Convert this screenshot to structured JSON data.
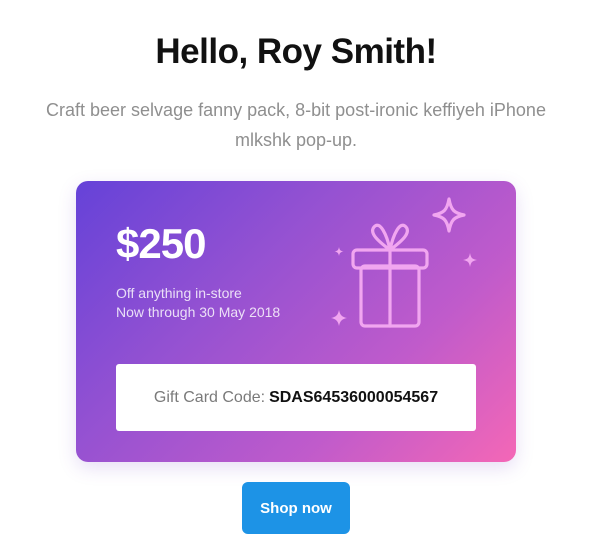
{
  "header": {
    "greeting": "Hello, Roy Smith!",
    "subtitle": "Craft beer selvage fanny pack, 8-bit post-ironic keffiyeh iPhone mlkshk pop-up."
  },
  "gift_card": {
    "amount": "$250",
    "offer_line_1": "Off anything in-store",
    "offer_line_2": "Now through 30 May 2018",
    "code_label": "Gift Card Code:",
    "code_value": "SDAS64536000054567",
    "icons": [
      "gift-icon",
      "sparkle-icon"
    ]
  },
  "cta": {
    "label": "Shop now"
  },
  "colors": {
    "card_gradient_start": "#6542d8",
    "card_gradient_end": "#f467b6",
    "button": "#1d93e6",
    "title": "#111111",
    "subtitle": "#8f8f8f",
    "gift_art": "#f1a6f0"
  }
}
